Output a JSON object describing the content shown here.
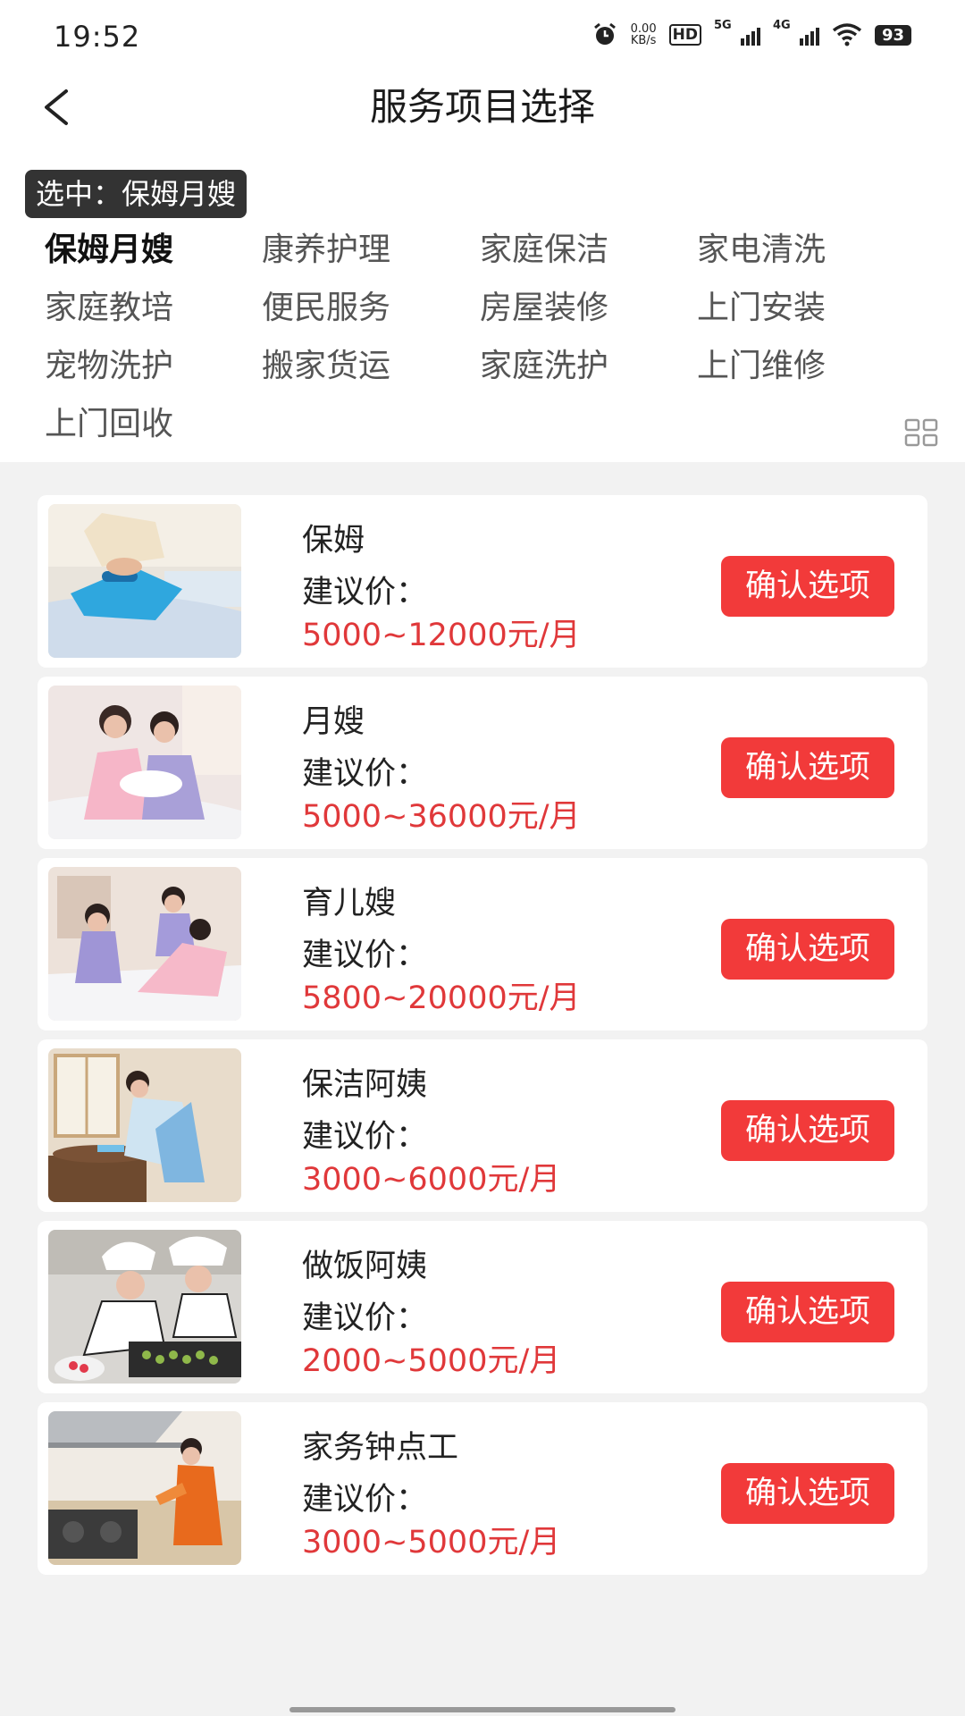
{
  "status": {
    "time": "19:52",
    "net_speed_top": "0.00",
    "net_speed_unit": "KB/s",
    "hd": "HD",
    "sig1": "5G",
    "sig2": "4G",
    "battery": "93"
  },
  "header": {
    "title": "服务项目选择"
  },
  "selected": {
    "prefix": "选中：",
    "value": "保姆月嫂"
  },
  "categories": [
    {
      "label": "保姆月嫂"
    },
    {
      "label": "康养护理"
    },
    {
      "label": "家庭保洁"
    },
    {
      "label": "家电清洗"
    },
    {
      "label": "家庭教培"
    },
    {
      "label": "便民服务"
    },
    {
      "label": "房屋装修"
    },
    {
      "label": "上门安装"
    },
    {
      "label": "宠物洗护"
    },
    {
      "label": "搬家货运"
    },
    {
      "label": "家庭洗护"
    },
    {
      "label": "上门维修"
    },
    {
      "label": "上门回收"
    }
  ],
  "services": [
    {
      "name": "保姆",
      "price_label": "建议价：",
      "price": "5000~12000元/月",
      "button": "确认选项"
    },
    {
      "name": "月嫂",
      "price_label": "建议价：",
      "price": "5000~36000元/月",
      "button": "确认选项"
    },
    {
      "name": "育儿嫂",
      "price_label": "建议价：",
      "price": "5800~20000元/月",
      "button": "确认选项"
    },
    {
      "name": "保洁阿姨",
      "price_label": "建议价：",
      "price": "3000~6000元/月",
      "button": "确认选项"
    },
    {
      "name": "做饭阿姨",
      "price_label": "建议价：",
      "price": "2000~5000元/月",
      "button": "确认选项"
    },
    {
      "name": "家务钟点工",
      "price_label": "建议价：",
      "price": "3000~5000元/月",
      "button": "确认选项"
    }
  ],
  "colors": {
    "accent": "#f23a3a",
    "price": "#e0383a",
    "tag_bg": "#333333"
  }
}
